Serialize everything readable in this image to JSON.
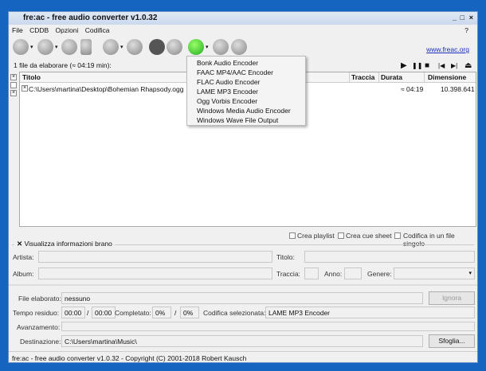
{
  "window": {
    "title": "fre:ac - free audio converter v1.0.32",
    "controls": [
      "_",
      "□",
      "×"
    ]
  },
  "menu": [
    "File",
    "CDDB",
    "Opzioni",
    "Codifica"
  ],
  "help": "?",
  "link": "www.freac.org",
  "encoder_menu": [
    "Bonk Audio Encoder",
    "FAAC MP4/AAC Encoder",
    "FLAC Audio Encoder",
    "LAME MP3 Encoder",
    "Ogg Vorbis Encoder",
    "Windows Media Audio Encoder",
    "Windows Wave File Output"
  ],
  "summary": "1 file da elaborare (≈ 04:19 min):",
  "player": [
    "▶",
    "❚❚",
    "■",
    "|◀",
    "▶|",
    "⏏"
  ],
  "columns": {
    "title": "Titolo",
    "track": "Traccia",
    "duration": "Durata",
    "size": "Dimensione"
  },
  "rows": [
    {
      "path": "C:\\Users\\martina\\Desktop\\Bohemian Rhapsody.ogg",
      "duration": "≈ 04:19",
      "size": "10.398.641"
    }
  ],
  "options": {
    "playlist": "Crea playlist",
    "cue": "Crea cue sheet",
    "single": "Codifica in un file singolo"
  },
  "info": {
    "toggle": "Visualizza informazioni brano",
    "artist": "Artista:",
    "title": "Titolo:",
    "album": "Album:",
    "track": "Traccia:",
    "year": "Anno:",
    "genre": "Genere:"
  },
  "progress": {
    "file_label": "File elaborato:",
    "file": "nessuno",
    "skip": "Ignora",
    "time_label": "Tempo residuo:",
    "time1": "00:00",
    "time2": "00:00",
    "slash": "/",
    "done_label": "Completato:",
    "done1": "0%",
    "done2": "0%",
    "enc_label": "Codifica selezionata:",
    "encoder": "LAME MP3 Encoder",
    "bar_label": "Avanzamento:",
    "bar_value": 0,
    "dest_label": "Destinazione:",
    "dest": "C:\\Users\\martina\\Music\\",
    "browse": "Sfoglia..."
  },
  "status": "fre:ac - free audio converter v1.0.32 - Copyright (C) 2001-2018 Robert Kausch"
}
